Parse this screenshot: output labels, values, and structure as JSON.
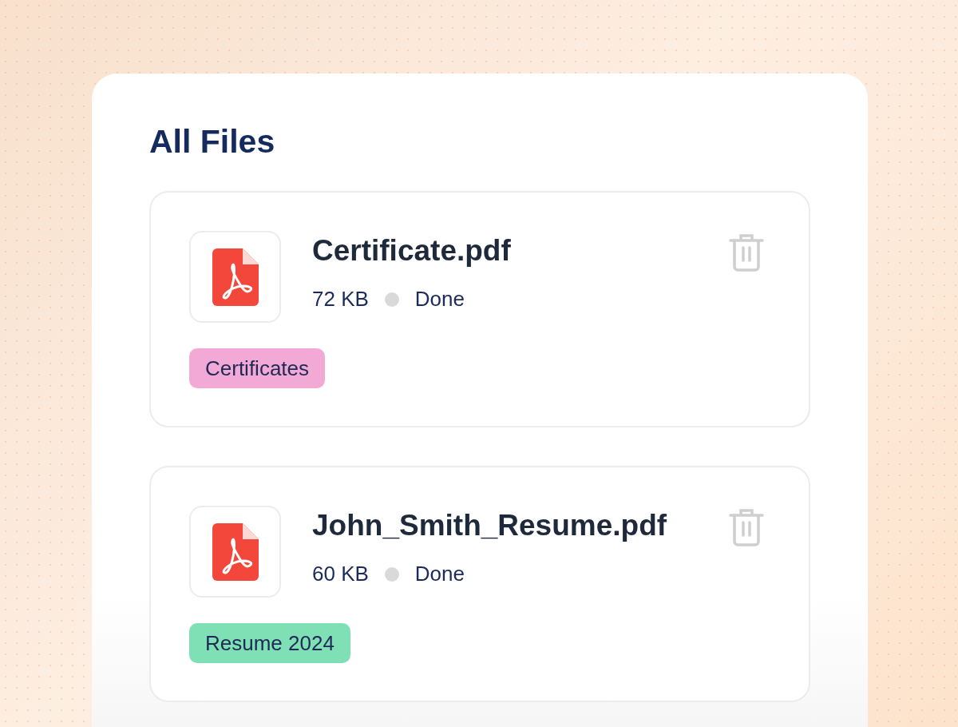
{
  "title": "All Files",
  "files": [
    {
      "name": "Certificate.pdf",
      "size": "72 KB",
      "status": "Done",
      "tag": {
        "label": "Certificates",
        "color": "#f2a9d6"
      }
    },
    {
      "name": "John_Smith_Resume.pdf",
      "size": "60 KB",
      "status": "Done",
      "tag": {
        "label": "Resume 2024",
        "color": "#7ee0b4"
      }
    }
  ]
}
